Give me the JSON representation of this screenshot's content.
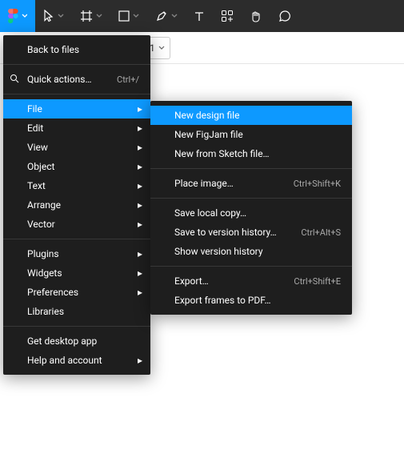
{
  "toolbar": {
    "tools": [
      "figma",
      "move",
      "frame",
      "shape",
      "pen",
      "text",
      "plugins",
      "hand",
      "comment"
    ]
  },
  "layer_dropdown": {
    "label": "1"
  },
  "menu_main": {
    "back": "Back to files",
    "quick": {
      "label": "Quick actions…",
      "shortcut": "Ctrl+/"
    },
    "items": [
      {
        "label": "File",
        "submenu": true,
        "hl": true
      },
      {
        "label": "Edit",
        "submenu": true
      },
      {
        "label": "View",
        "submenu": true
      },
      {
        "label": "Object",
        "submenu": true
      },
      {
        "label": "Text",
        "submenu": true
      },
      {
        "label": "Arrange",
        "submenu": true
      },
      {
        "label": "Vector",
        "submenu": true
      }
    ],
    "plugins": {
      "label": "Plugins",
      "submenu": true
    },
    "widgets": {
      "label": "Widgets",
      "submenu": true
    },
    "preferences": {
      "label": "Preferences",
      "submenu": true
    },
    "libraries": {
      "label": "Libraries"
    },
    "desktop": {
      "label": "Get desktop app"
    },
    "help": {
      "label": "Help and account",
      "submenu": true
    }
  },
  "menu_file": {
    "g1": [
      {
        "label": "New design file",
        "hl": true
      },
      {
        "label": "New FigJam file"
      },
      {
        "label": "New from Sketch file…"
      }
    ],
    "g2": [
      {
        "label": "Place image…",
        "shortcut": "Ctrl+Shift+K"
      }
    ],
    "g3": [
      {
        "label": "Save local copy…"
      },
      {
        "label": "Save to version history…",
        "shortcut": "Ctrl+Alt+S"
      },
      {
        "label": "Show version history"
      }
    ],
    "g4": [
      {
        "label": "Export…",
        "shortcut": "Ctrl+Shift+E"
      },
      {
        "label": "Export frames to PDF…"
      }
    ]
  }
}
